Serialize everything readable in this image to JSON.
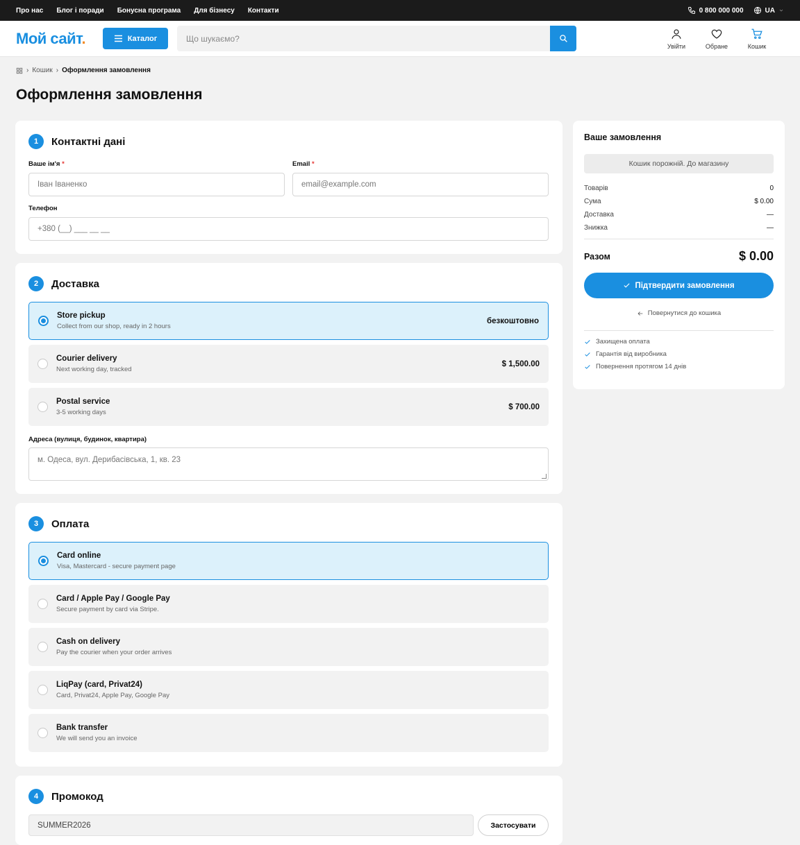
{
  "topbar": {
    "links": [
      "Про нас",
      "Блог і поради",
      "Бонусна програма",
      "Для бізнесу",
      "Контакти"
    ],
    "phone": "0 800 000 000",
    "lang": "UA"
  },
  "header": {
    "logo_main": "Мой сайт",
    "logo_dot": ".",
    "catalog_label": "Каталог",
    "search_placeholder": "Що шукаємо?",
    "icons": [
      {
        "label": "Увійти",
        "icon": "user-icon"
      },
      {
        "label": "Обране",
        "icon": "heart-icon"
      },
      {
        "label": "Кошик",
        "icon": "cart-icon"
      }
    ]
  },
  "breadcrumb": {
    "items": [
      "Кошик",
      "Оформлення замовлення"
    ]
  },
  "page_title": "Оформлення замовлення",
  "contact": {
    "number": "1",
    "title": "Контактні дані",
    "name_label": "Ваше ім'я",
    "name_placeholder": "Іван Іваненко",
    "email_label": "Email",
    "email_placeholder": "email@example.com",
    "phone_label": "Телефон",
    "phone_placeholder": "+380 (__) ___ __ __",
    "required_mark": "*"
  },
  "delivery": {
    "number": "2",
    "title": "Доставка",
    "options": [
      {
        "title": "Store pickup",
        "sub": "Collect from our shop, ready in 2 hours",
        "price": "безкоштовно",
        "selected": true
      },
      {
        "title": "Courier delivery",
        "sub": "Next working day, tracked",
        "price": "$ 1,500.00",
        "selected": false
      },
      {
        "title": "Postal service",
        "sub": "3-5 working days",
        "price": "$ 700.00",
        "selected": false
      }
    ],
    "address_label": "Адреса (вулиця, будинок, квартира)",
    "address_placeholder": "м. Одеса, вул. Дерибасівська, 1, кв. 23"
  },
  "payment": {
    "number": "3",
    "title": "Оплата",
    "options": [
      {
        "title": "Card online",
        "sub": "Visa, Mastercard - secure payment page",
        "selected": true
      },
      {
        "title": "Card / Apple Pay / Google Pay",
        "sub": "Secure payment by card via Stripe.",
        "selected": false
      },
      {
        "title": "Cash on delivery",
        "sub": "Pay the courier when your order arrives",
        "selected": false
      },
      {
        "title": "LiqPay (card, Privat24)",
        "sub": "Card, Privat24, Apple Pay, Google Pay",
        "selected": false
      },
      {
        "title": "Bank transfer",
        "sub": "We will send you an invoice",
        "selected": false
      }
    ]
  },
  "promo": {
    "number": "4",
    "title": "Промокод",
    "value": "SUMMER2026",
    "apply_label": "Застосувати"
  },
  "order": {
    "title": "Ваше замовлення",
    "empty_text": "Кошик порожній. До магазину",
    "rows": [
      {
        "label": "Товарів",
        "value": "0"
      },
      {
        "label": "Сума",
        "value": "$ 0.00"
      },
      {
        "label": "Доставка",
        "value": "—"
      },
      {
        "label": "Знижка",
        "value": "—"
      }
    ],
    "total_label": "Разом",
    "total_value": "$ 0.00",
    "confirm_label": "Підтвердити замовлення",
    "back_label": "Повернутися до кошика",
    "guarantees": [
      "Захищена оплата",
      "Гарантія від виробника",
      "Повернення протягом 14 днів"
    ]
  },
  "colors": {
    "accent": "#1a8fe0",
    "logo_dot": "#f28c28",
    "topbar": "#1b1b1b"
  }
}
